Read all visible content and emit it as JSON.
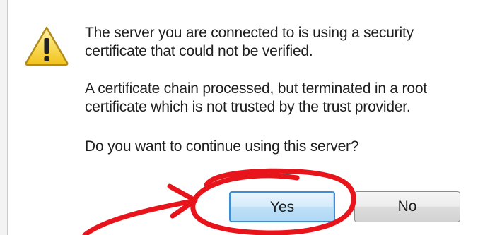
{
  "dialog": {
    "icon": "warning-icon",
    "message_1": "The server you are connected to is using a security certificate that could not be verified.",
    "message_2": "A certificate chain processed, but terminated in a root certificate which is not trusted by the trust provider.",
    "question": "Do you want to continue using this server?",
    "buttons": {
      "yes_label": "Yes",
      "no_label": "No"
    }
  },
  "annotation": {
    "type": "red-circle-with-arrow",
    "color": "#e8141c",
    "target": "yes-button"
  },
  "colors": {
    "yes_button_border": "#3c8ed6",
    "dialog_background": "#ffffff"
  }
}
